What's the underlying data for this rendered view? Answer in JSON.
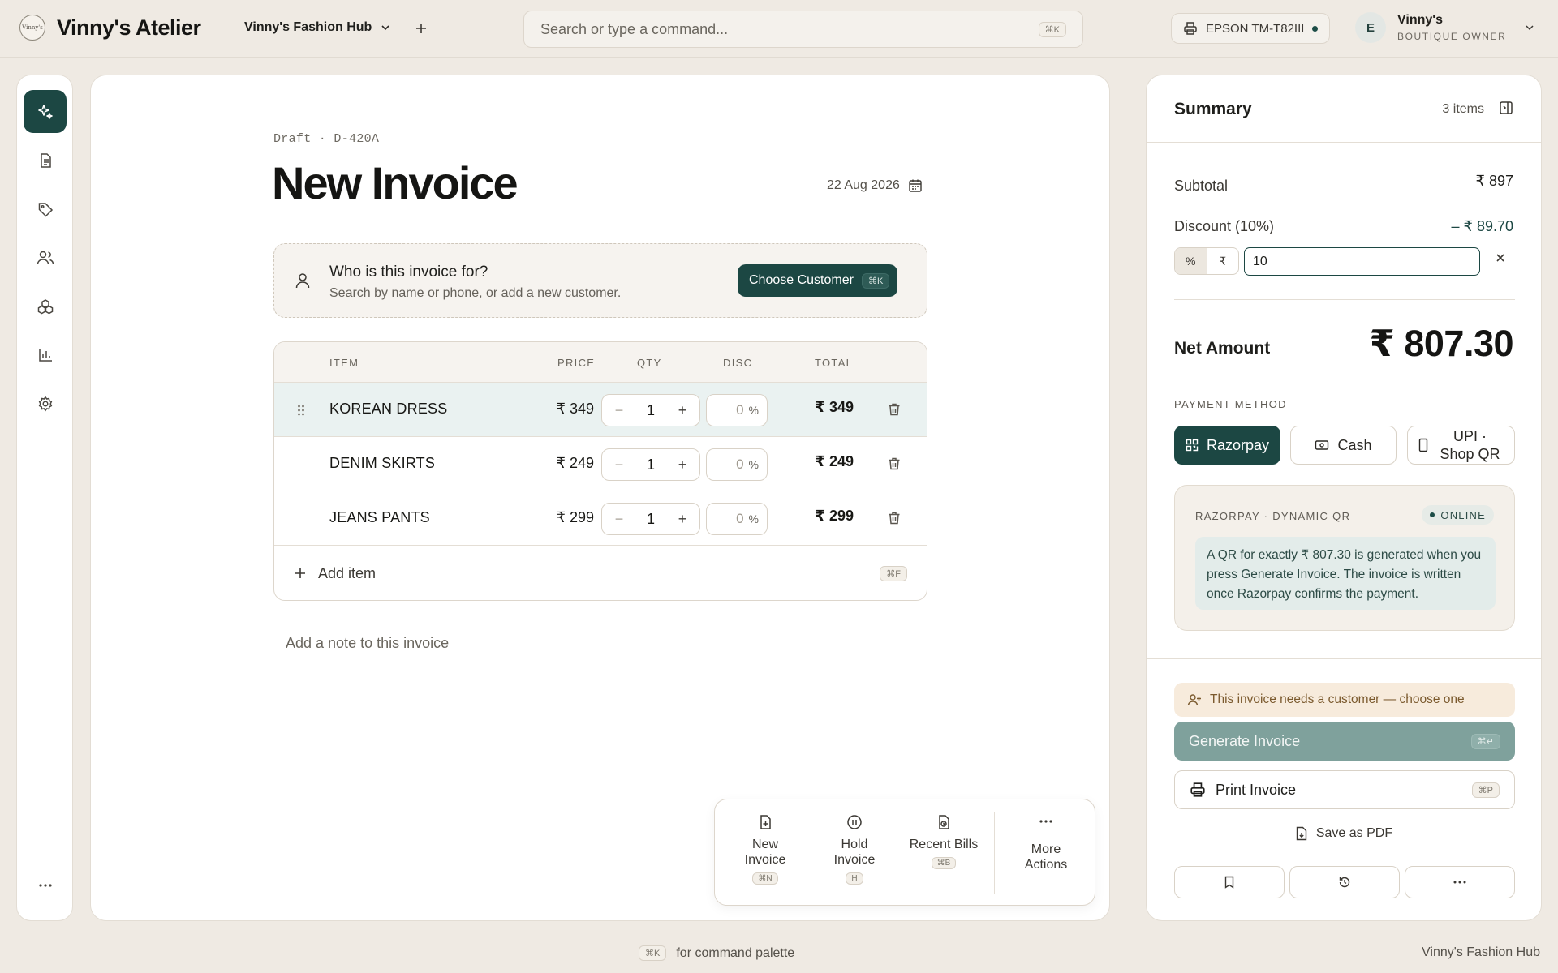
{
  "app": {
    "brand": "Vinny's Atelier",
    "logo_text": "Vinny's",
    "store": "Vinny's Fashion Hub"
  },
  "search": {
    "placeholder": "Search or type a command...",
    "shortcut": "⌘K"
  },
  "printer": {
    "name": "EPSON TM-T82III",
    "status_color": "#1d4d47"
  },
  "user": {
    "initial": "E",
    "name": "Vinny's",
    "role": "BOUTIQUE OWNER"
  },
  "rail": {
    "items": [
      "sparkle-icon",
      "document-icon",
      "tag-icon",
      "users-icon",
      "boxes-icon",
      "chart-icon",
      "settings-icon"
    ],
    "more": "more-icon"
  },
  "invoice": {
    "draft_label": "Draft · D-420A",
    "title": "New Invoice",
    "date": "22 Aug 2026",
    "customer_question": "Who is this invoice for?",
    "customer_hint": "Search by name or phone, or add a new customer.",
    "choose_customer": "Choose Customer",
    "choose_customer_shortcut": "⌘K",
    "columns": {
      "item": "ITEM",
      "price": "PRICE",
      "qty": "QTY",
      "disc": "DISC",
      "total": "TOTAL"
    },
    "rows": [
      {
        "name": "KOREAN DRESS",
        "price": "₹ 349",
        "qty": "1",
        "disc": "0",
        "disc_unit": "%",
        "total": "₹ 349"
      },
      {
        "name": "DENIM SKIRTS",
        "price": "₹ 249",
        "qty": "1",
        "disc": "0",
        "disc_unit": "%",
        "total": "₹ 249"
      },
      {
        "name": "JEANS PANTS",
        "price": "₹ 299",
        "qty": "1",
        "disc": "0",
        "disc_unit": "%",
        "total": "₹ 299"
      }
    ],
    "minus": "−",
    "plus": "+",
    "add_item": "Add item",
    "add_item_shortcut": "⌘F",
    "note_placeholder": "Add a note to this invoice"
  },
  "actions": {
    "new_invoice": "New Invoice",
    "new_invoice_shortcut": "⌘N",
    "hold_invoice": "Hold Invoice",
    "hold_invoice_shortcut": "H",
    "recent_bills": "Recent Bills",
    "recent_bills_shortcut": "⌘B",
    "more_actions": "More Actions"
  },
  "summary": {
    "title": "Summary",
    "count": "3 items",
    "subtotal_label": "Subtotal",
    "subtotal": "₹ 897",
    "discount_label": "Discount (10%)",
    "discount": "– ₹ 89.70",
    "discount_mode_pct": "%",
    "discount_mode_amt": "₹",
    "discount_value": "10",
    "net_label": "Net Amount",
    "net_amount": "₹ 807.30",
    "payment_label": "PAYMENT METHOD",
    "methods": [
      "Razorpay",
      "Cash",
      "UPI · Shop QR"
    ],
    "selected_method": "Razorpay",
    "rzp_title": "RAZORPAY · DYNAMIC QR",
    "rzp_status": "ONLINE",
    "rzp_body": "A QR for exactly ₹ 807.30 is generated when you press Generate Invoice. The invoice is written once Razorpay confirms the payment.",
    "warning": "This invoice needs a customer — choose one",
    "generate": "Generate Invoice",
    "generate_shortcut": "⌘↵",
    "print": "Print Invoice",
    "print_shortcut": "⌘P",
    "save_pdf": "Save as PDF"
  },
  "footer": {
    "shortcut": "⌘K",
    "hint": "for command palette",
    "store": "Vinny's Fashion Hub"
  },
  "colors": {
    "accent": "#1c4743",
    "background": "#efeae3",
    "warning_bg": "#f7ebdc"
  }
}
